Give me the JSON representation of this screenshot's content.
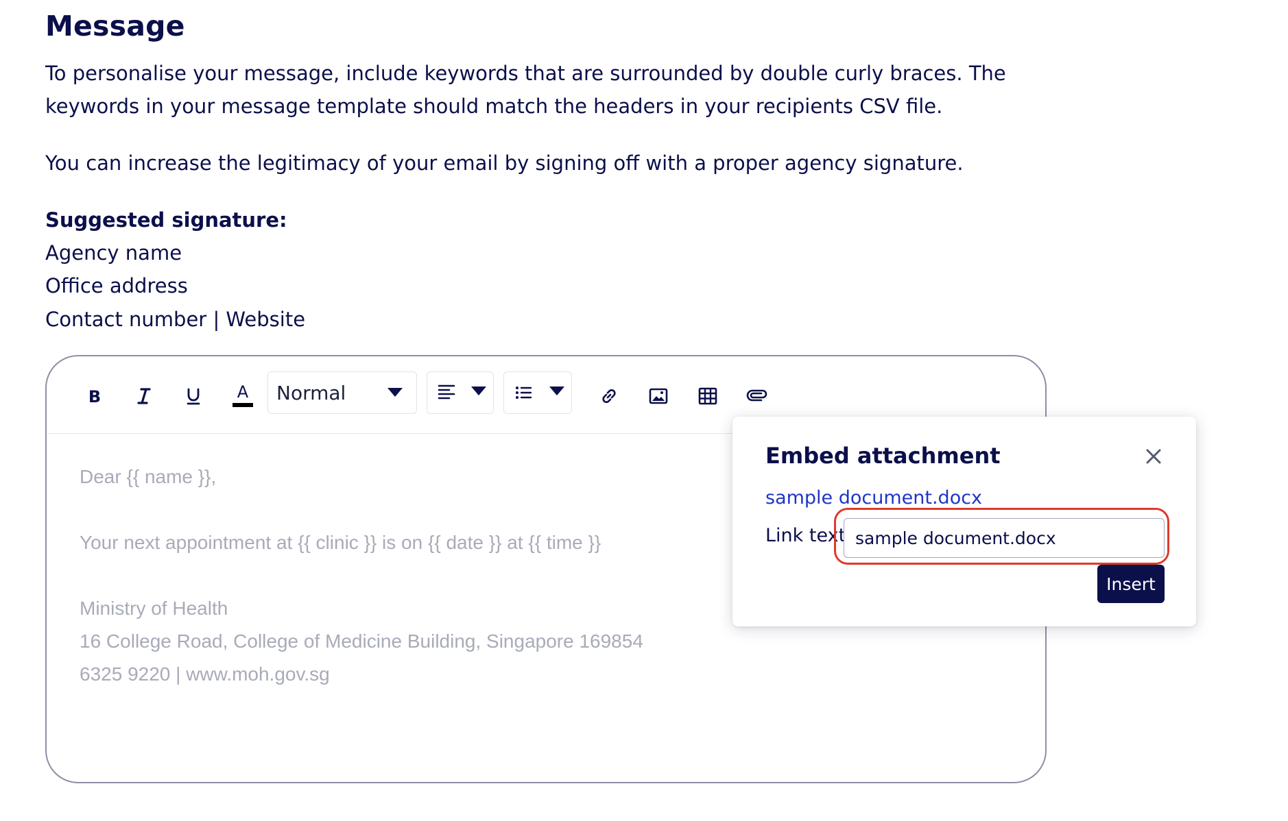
{
  "page": {
    "title": "Message",
    "intro": "To personalise your message, include keywords that are surrounded by double curly braces. The keywords in your message template should match the headers in your recipients CSV file.",
    "legitimacy": "You can increase the legitimacy of your email by signing off with a proper agency signature.",
    "signature_heading": "Suggested signature:",
    "signature_lines": [
      "Agency name",
      "Office address",
      "Contact number | Website"
    ]
  },
  "toolbar": {
    "format_value": "Normal",
    "icons": [
      "bold-icon",
      "italic-icon",
      "underline-icon",
      "font-color-icon",
      "align-icon",
      "list-icon",
      "link-icon",
      "image-icon",
      "table-icon",
      "attachment-icon"
    ]
  },
  "editor": {
    "placeholder_lines": [
      "Dear {{ name }},",
      "Your next appointment at {{ clinic }} is on {{ date }} at {{ time }}",
      "Ministry of Health",
      "16 College Road, College of Medicine Building, Singapore 169854",
      "6325 9220 | www.moh.gov.sg"
    ]
  },
  "popover": {
    "title": "Embed attachment",
    "file_link": "sample document.docx",
    "link_text_label": "Link text",
    "link_text_value": "sample document.docx",
    "insert_label": "Insert"
  },
  "colors": {
    "navy": "#0b0f4a",
    "link_blue": "#1f35c9",
    "placeholder_grey": "#a8abb8",
    "highlight_red": "#e03a2a"
  }
}
